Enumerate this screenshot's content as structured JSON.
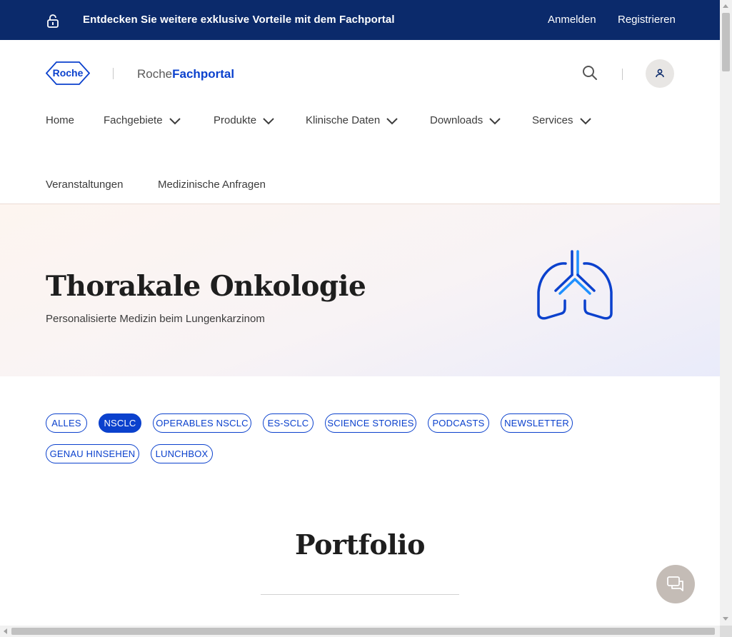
{
  "topbar": {
    "message": "Entdecken Sie weitere exklusive Vorteile mit dem Fachportal",
    "login": "Anmelden",
    "register": "Registrieren",
    "icon": "lock-open-icon"
  },
  "header": {
    "logo_text": "Roche",
    "brand_light": "Roche",
    "brand_bold": "Fachportal",
    "search_icon": "search-icon",
    "user_icon": "user-icon"
  },
  "nav": {
    "items": [
      {
        "label": "Home"
      },
      {
        "label": "Fachgebiete"
      },
      {
        "label": "Produkte"
      },
      {
        "label": "Klinische Daten"
      },
      {
        "label": "Downloads"
      },
      {
        "label": "Services"
      },
      {
        "label": "Veranstaltungen"
      },
      {
        "label": "Medizinische Anfragen"
      }
    ]
  },
  "hero": {
    "title": "Thorakale Onkologie",
    "subtitle": "Personalisierte Medizin beim Lungenkarzinom",
    "icon": "lungs-icon"
  },
  "filters": {
    "chips": [
      {
        "label": "ALLES"
      },
      {
        "label": "NSCLC"
      },
      {
        "label": "OPERABLES NSCLC"
      },
      {
        "label": "ES-SCLC"
      },
      {
        "label": "SCIENCE STORIES"
      },
      {
        "label": "PODCASTS"
      },
      {
        "label": "NEWSLETTER"
      },
      {
        "label": "GENAU HINSEHEN"
      },
      {
        "label": "LUNCHBOX"
      }
    ],
    "active": "NSCLC"
  },
  "portfolio": {
    "title": "Portfolio"
  },
  "colors": {
    "topbar": "#0b2a6b",
    "accent": "#0b41cd",
    "chat": "#c4bcb6"
  }
}
